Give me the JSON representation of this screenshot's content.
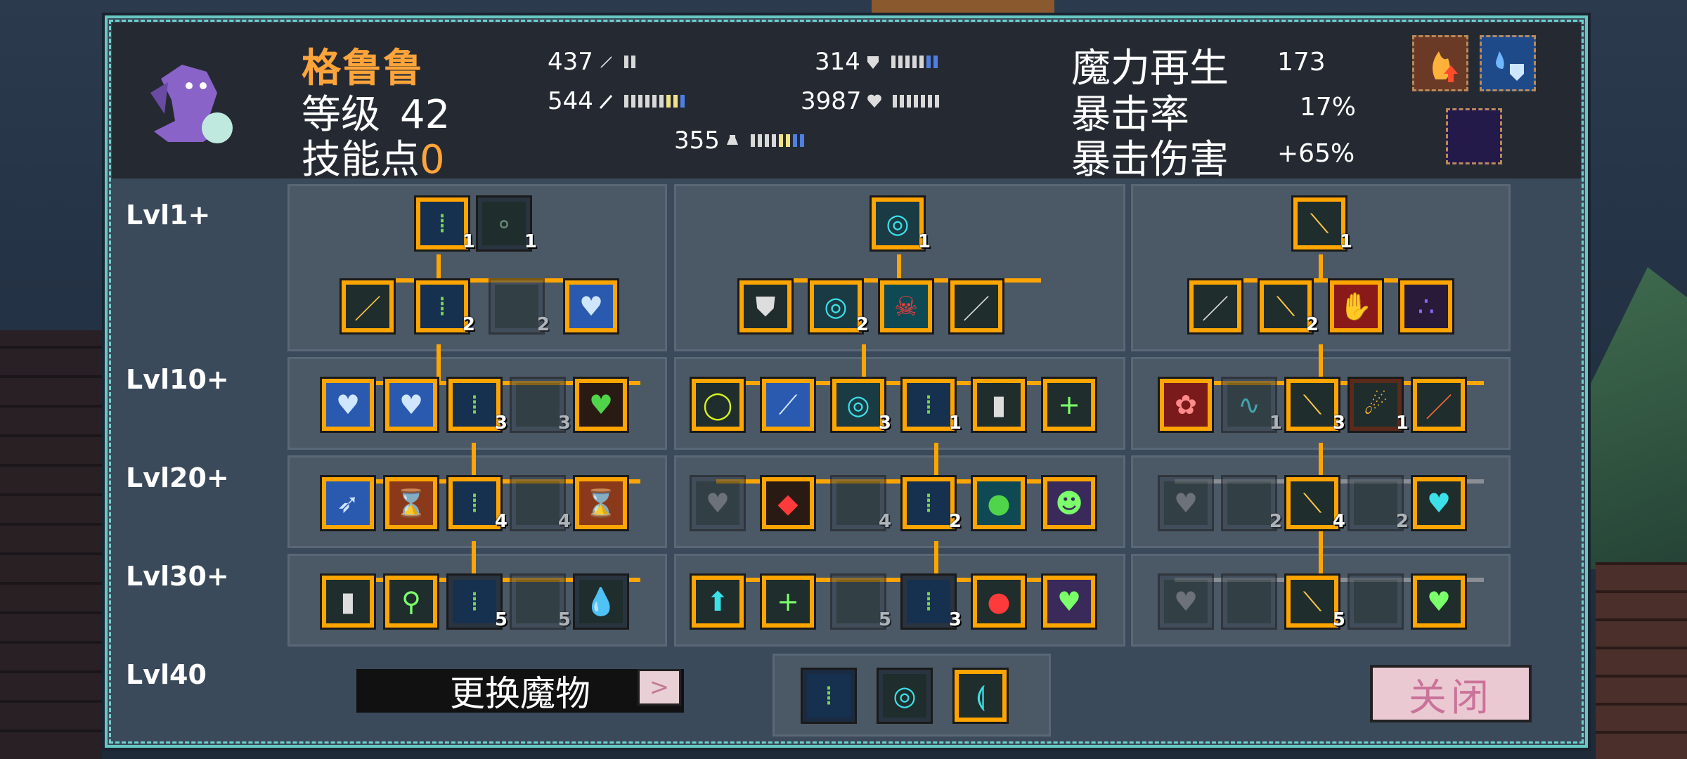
{
  "monster": {
    "name": "格鲁鲁",
    "level_label": "等级",
    "level": "42",
    "skill_points_label": "技能点",
    "skill_points": "0"
  },
  "stats": {
    "attack": "437",
    "magic_attack": "544",
    "mana": "355",
    "defense": "314",
    "health": "3987"
  },
  "right_stats": {
    "mana_regen_label": "魔力再生",
    "mana_regen": "173",
    "crit_rate_label": "暴击率",
    "crit_rate": "17%",
    "crit_damage_label": "暴击伤害",
    "crit_damage": "+65%"
  },
  "row_labels": [
    "Lvl1+",
    "Lvl10+",
    "Lvl20+",
    "Lvl30+",
    "Lvl40"
  ],
  "tiles": {
    "t_l1_a": "1",
    "t_l1_b": "1",
    "t_l2_b": "2",
    "t_l2_c": "2",
    "t_l3_c": "3",
    "t_l3_d": "3",
    "t_l4_c": "4",
    "t_l4_d": "4",
    "t_l5_c": "5",
    "t_l5_d": "5",
    "t_m1": "1",
    "t_m2": "2",
    "t_m3": "3",
    "t_m3b": "1",
    "t_m4": "4",
    "t_m4b": "2",
    "t_m5": "5",
    "t_m5b": "3",
    "t_r1": "1",
    "t_r2": "2",
    "t_r3": "3",
    "t_r3a": "1",
    "t_r3c": "1",
    "t_r4": "4",
    "t_r4a": "2",
    "t_r4b": "2",
    "t_r5": "5"
  },
  "bottom": {
    "swap_label": "更换魔物",
    "prev_arrow": "<",
    "next_arrow": ">",
    "close_label": "关闭"
  },
  "colors": {
    "accent_orange": "#ffa500",
    "name_orange": "#ffa43a",
    "panel_bg": "#3a4a5b",
    "frame_cyan": "#6fd1cb"
  }
}
